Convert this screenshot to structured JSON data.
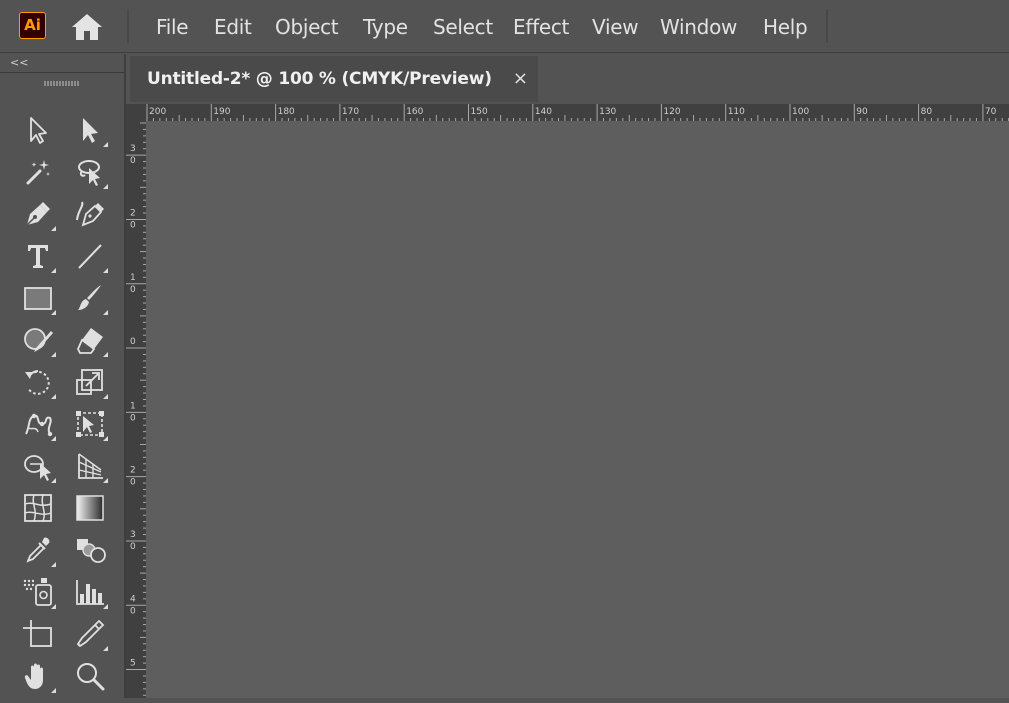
{
  "app": {
    "logo_text": "Ai",
    "brand_color": "#ff9a00",
    "home_icon": "home-icon"
  },
  "menu": [
    {
      "label": "File"
    },
    {
      "label": "Edit"
    },
    {
      "label": "Object"
    },
    {
      "label": "Type"
    },
    {
      "label": "Select"
    },
    {
      "label": "Effect"
    },
    {
      "label": "View"
    },
    {
      "label": "Window"
    },
    {
      "label": "Help"
    }
  ],
  "toolbar": {
    "collapse_label": "<<",
    "tools": [
      {
        "name": "selection-tool-icon"
      },
      {
        "name": "direct-selection-tool-icon"
      },
      {
        "name": "magic-wand-tool-icon"
      },
      {
        "name": "lasso-tool-icon"
      },
      {
        "name": "pen-tool-icon"
      },
      {
        "name": "curvature-tool-icon"
      },
      {
        "name": "type-tool-icon"
      },
      {
        "name": "line-segment-tool-icon"
      },
      {
        "name": "rectangle-tool-icon"
      },
      {
        "name": "paintbrush-tool-icon"
      },
      {
        "name": "shaper-tool-icon"
      },
      {
        "name": "eraser-tool-icon"
      },
      {
        "name": "rotate-tool-icon"
      },
      {
        "name": "scale-tool-icon"
      },
      {
        "name": "puppet-warp-tool-icon"
      },
      {
        "name": "free-transform-tool-icon"
      },
      {
        "name": "shape-builder-tool-icon"
      },
      {
        "name": "perspective-grid-tool-icon"
      },
      {
        "name": "mesh-tool-icon"
      },
      {
        "name": "gradient-tool-icon"
      },
      {
        "name": "eyedropper-tool-icon"
      },
      {
        "name": "blend-tool-icon"
      },
      {
        "name": "symbol-sprayer-tool-icon"
      },
      {
        "name": "column-graph-tool-icon"
      },
      {
        "name": "artboard-tool-icon"
      },
      {
        "name": "slice-tool-icon"
      },
      {
        "name": "hand-tool-icon"
      },
      {
        "name": "zoom-tool-icon"
      }
    ]
  },
  "document": {
    "tab_title": "Untitled-2* @ 100 % (CMYK/Preview)",
    "close_label": "×",
    "canvas_color": "#5e5e5e"
  },
  "rulers": {
    "horizontal": [
      "200",
      "190",
      "180",
      "170",
      "160",
      "150",
      "140",
      "130",
      "120",
      "110",
      "100",
      "90",
      "80",
      "70"
    ],
    "vertical": [
      "30",
      "20",
      "10",
      "0",
      "10",
      "20",
      "30",
      "40",
      "5"
    ]
  }
}
